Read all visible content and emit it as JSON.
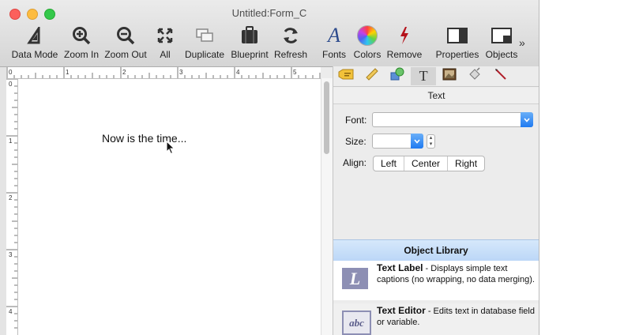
{
  "window": {
    "title": "Untitled:Form_C"
  },
  "toolbar": {
    "buttons": [
      {
        "label": "Data Mode",
        "icon": "data-mode-icon"
      },
      {
        "label": "Zoom In",
        "icon": "zoom-in-icon"
      },
      {
        "label": "Zoom Out",
        "icon": "zoom-out-icon"
      },
      {
        "label": "All",
        "icon": "zoom-all-icon"
      },
      {
        "label": "Duplicate",
        "icon": "duplicate-icon"
      },
      {
        "label": "Blueprint",
        "icon": "blueprint-icon"
      },
      {
        "label": "Refresh",
        "icon": "refresh-icon"
      },
      {
        "label": "Fonts",
        "icon": "fonts-icon"
      },
      {
        "label": "Colors",
        "icon": "colors-icon"
      },
      {
        "label": "Remove",
        "icon": "remove-icon"
      },
      {
        "label": "Properties",
        "icon": "properties-icon"
      },
      {
        "label": "Objects",
        "icon": "objects-icon"
      }
    ],
    "overflow": "»"
  },
  "ruler": {
    "h_labels": [
      "0",
      "1",
      "2",
      "3",
      "4",
      "5"
    ],
    "v_labels": [
      "0",
      "1",
      "2",
      "3",
      "4"
    ]
  },
  "canvas": {
    "text": "Now is the time..."
  },
  "panel": {
    "section_title": "Text",
    "font_label": "Font:",
    "font_value": "",
    "size_label": "Size:",
    "size_value": "",
    "align_label": "Align:",
    "align_options": [
      "Left",
      "Center",
      "Right"
    ],
    "library_title": "Object Library",
    "library_items": [
      {
        "title": "Text Label",
        "desc": " - Displays simple text captions (no wrapping, no data merging).",
        "icon_text": "L"
      },
      {
        "title": "Text Editor",
        "desc": " - Edits text in database field or variable.",
        "icon_text": "abc"
      }
    ]
  },
  "colors": {
    "accent": "#1f7af1",
    "library_header": "#c9e0f9",
    "icon_bg": "#8d8fb4",
    "remove_red": "#b5121b"
  }
}
